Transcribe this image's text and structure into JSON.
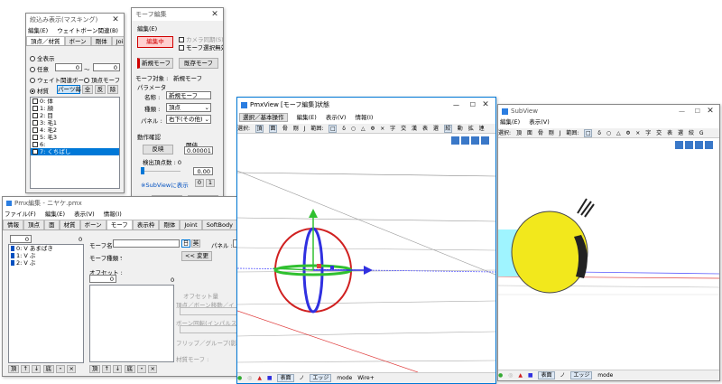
{
  "filter_window": {
    "title": "絞込み表示(マスキング)",
    "menu": [
      "編集(E)",
      "ウェイトボーン関連(B)"
    ],
    "tabs": [
      "頂点／材質",
      "ボーン",
      "剛体",
      "Joint"
    ],
    "options": {
      "show_all": "全表示",
      "any": "任意",
      "range_from": "0",
      "range_sep": "～",
      "range_to": "0",
      "weight_bone": "ウェイト関連ボーン",
      "vertex_morph": "頂点モーフ",
      "material": "材質"
    },
    "buttons": {
      "parts": "パーツ毎",
      "all": "全",
      "invert": "反",
      "remove": "除"
    },
    "items": [
      "0: 体",
      "1: 顔",
      "2: 目",
      "3: 毛1",
      "4: 毛2",
      "5: 毛3",
      "6: ",
      "7: くちばし"
    ]
  },
  "morph_window": {
    "title": "モーフ編集",
    "menu": "編集(E)",
    "editing_button": "編集中",
    "subview_check": "カメラ同期(S)",
    "select_disable": "モーフ選択無効",
    "new_morph": "新規モーフ",
    "existing_morph": "既存モーフ",
    "target_label": "モーフ対象 :",
    "target_value": "新規モーフ",
    "param_label": "パラメータ",
    "name_label": "名称 :",
    "name_value": "新規モーフ",
    "type_label": "種類 :",
    "type_value": "頂点",
    "panel_label": "パネル :",
    "panel_value": "右下(その他)",
    "action_label": "動作確認",
    "invert_button": "反映",
    "threshold_label": "閾値",
    "threshold_value": "0.00001",
    "vertex_count": "検出頂点数 : 0",
    "slider_value": "0.00",
    "subview_link": "※SubViewに表示",
    "btn_0": "0",
    "btn_1": "1",
    "add_button": "追加",
    "update_button": "更新"
  },
  "pmx_editor": {
    "title": "Pmx編集 - ニヤケ.pmx",
    "menu": [
      "ファイル(F)",
      "編集(E)",
      "表示(V)",
      "情報(I)"
    ],
    "tabs": [
      "情報",
      "頂点",
      "面",
      "材質",
      "ボーン",
      "モーフ",
      "表示枠",
      "剛体",
      "Joint",
      "SoftBody"
    ],
    "list_header": "0",
    "list_header_right": "0",
    "morph_list": [
      "0: V あまばき",
      "1: V ぶ",
      "2: V ぶ"
    ],
    "morph_name_label": "モーフ名 :",
    "lang_jp": "日",
    "lang_en": "英",
    "panel_label": "パネル :",
    "morph_type_label": "モーフ種類 :",
    "morph_type_value": "-",
    "change_button": "<< 変更",
    "offset_label": "オフセット :",
    "offset_value": "0",
    "offset_right": "0",
    "index_label": "オフセット量",
    "vertex_move": "頂点／ボーン移動／イ",
    "bone_rotate": "ボーン回転(インパルス",
    "flip_group": "フリップ／グループ(影響",
    "material_morph": "材質モーフ :",
    "nav_buttons": [
      "頂",
      "↑",
      "↓",
      "底",
      "・",
      "×"
    ]
  },
  "pmx_view": {
    "title": "PmxView [モーフ編集]状態",
    "menu": [
      "選択／基本操作",
      "編集(E)",
      "表示(V)",
      "情報(I)"
    ],
    "toolbar": [
      "選択:",
      "頂",
      "面",
      "骨",
      "剛",
      "J",
      "範囲:",
      "□",
      "δ",
      "○",
      "△",
      "Φ",
      "×",
      "字",
      "交",
      "漢",
      "表",
      "選",
      "絞",
      "動",
      "拡",
      "連"
    ],
    "bottom": [
      "表面",
      "ノ",
      "エッジ",
      "mode",
      "Wire+"
    ]
  },
  "sub_view": {
    "title": "SubView",
    "menu": [
      "編集(E)",
      "表示(V)"
    ],
    "toolbar": [
      "選択:",
      "頂",
      "面",
      "骨",
      "剛",
      "J",
      "範囲:",
      "□",
      "δ",
      "○",
      "△",
      "Φ",
      "×",
      "字",
      "交",
      "表",
      "選",
      "絞",
      "G"
    ],
    "bottom": [
      "表面",
      "ノ",
      "エッジ",
      "mode"
    ]
  },
  "colors": {
    "accent": "#0078d7",
    "editing": "#d00000",
    "gizmo_red": "#d02020",
    "gizmo_green": "#30c030",
    "gizmo_blue": "#3030e0",
    "model_yellow": "#f2e81c",
    "model_cyan": "#9ff4ff"
  }
}
